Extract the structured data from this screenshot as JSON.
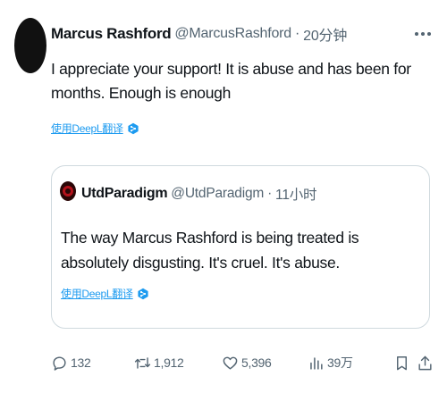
{
  "tweet": {
    "author_name": "Marcus Rashford",
    "handle": "@MarcusRashford",
    "separator": "·",
    "time": "20分钟",
    "text": "I appreciate your support! It is abuse and has been for months. Enough is enough",
    "translate_label": "使用DeepL翻译"
  },
  "quote": {
    "author_name": "UtdParadigm",
    "handle": "@UtdParadigm",
    "separator": "·",
    "time": "11小时",
    "text": "The way Marcus Rashford is being treated is absolutely disgusting. It's cruel. It's abuse.",
    "translate_label": "使用DeepL翻译"
  },
  "actions": {
    "replies": "132",
    "retweets": "1,912",
    "likes": "5,396",
    "views": "39万"
  },
  "icons": {
    "more": "more-icon",
    "translate": "deepl-icon",
    "reply": "reply-icon",
    "retweet": "retweet-icon",
    "like": "heart-icon",
    "views": "views-icon",
    "bookmark": "bookmark-icon",
    "share": "share-icon"
  },
  "colors": {
    "link": "#1d9bf0",
    "muted": "#536471",
    "text": "#0f1419",
    "border": "#cfd9de"
  }
}
